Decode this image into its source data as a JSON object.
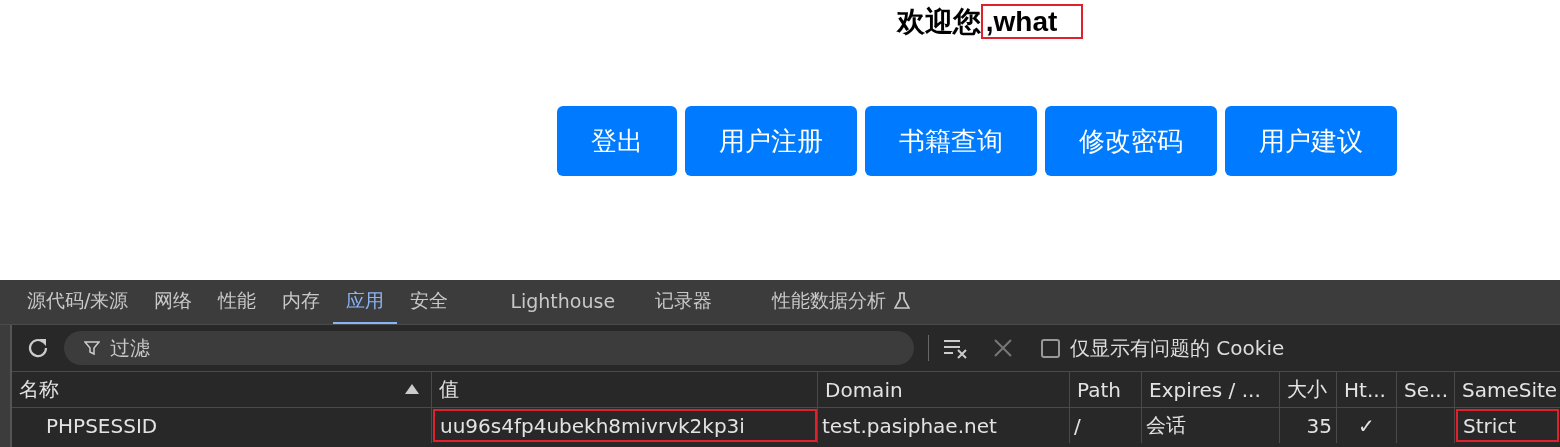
{
  "heading": {
    "parts": [
      {
        "text": "欢迎您",
        "highlighted": false
      },
      {
        "text": ",what",
        "highlighted": true
      }
    ]
  },
  "buttons": [
    "登出",
    "用户注册",
    "书籍查询",
    "修改密码",
    "用户建议"
  ],
  "devtools": {
    "tabs": [
      {
        "label": "源代码/来源",
        "selected": false
      },
      {
        "label": "网络",
        "selected": false
      },
      {
        "label": "性能",
        "selected": false
      },
      {
        "label": "内存",
        "selected": false
      },
      {
        "label": "应用",
        "selected": true
      },
      {
        "label": "安全",
        "selected": false
      },
      {
        "label": "Lighthouse",
        "selected": false
      },
      {
        "label": "记录器",
        "selected": false
      },
      {
        "label": "性能数据分析",
        "selected": false,
        "experimental": true
      }
    ],
    "filter": {
      "placeholder": "过滤"
    },
    "only_issues": {
      "label": "仅显示有问题的 Cookie",
      "checked": false
    },
    "table": {
      "columns": [
        {
          "label": "名称",
          "sorted": true
        },
        {
          "label": "值",
          "sorted": false
        },
        {
          "label": "Domain",
          "sorted": false
        },
        {
          "label": "Path",
          "sorted": false
        },
        {
          "label": "Expires / ...",
          "sorted": false
        },
        {
          "label": "大小",
          "sorted": false
        },
        {
          "label": "Ht...",
          "sorted": false
        },
        {
          "label": "Se...",
          "sorted": false
        },
        {
          "label": "SameSite",
          "sorted": false
        }
      ],
      "rows": [
        {
          "cells": [
            {
              "text": "PHPSESSID",
              "highlighted": false
            },
            {
              "text": "uu96s4fp4ubekh8mivrvk2kp3i",
              "highlighted": true
            },
            {
              "text": "test.pasiphae.net",
              "highlighted": false
            },
            {
              "text": "/",
              "highlighted": false
            },
            {
              "text": "会话",
              "highlighted": false
            },
            {
              "text": "35",
              "highlighted": false
            },
            {
              "text": "✓",
              "highlighted": false
            },
            {
              "text": "",
              "highlighted": false
            },
            {
              "text": "Strict",
              "highlighted": true
            }
          ]
        }
      ]
    }
  }
}
